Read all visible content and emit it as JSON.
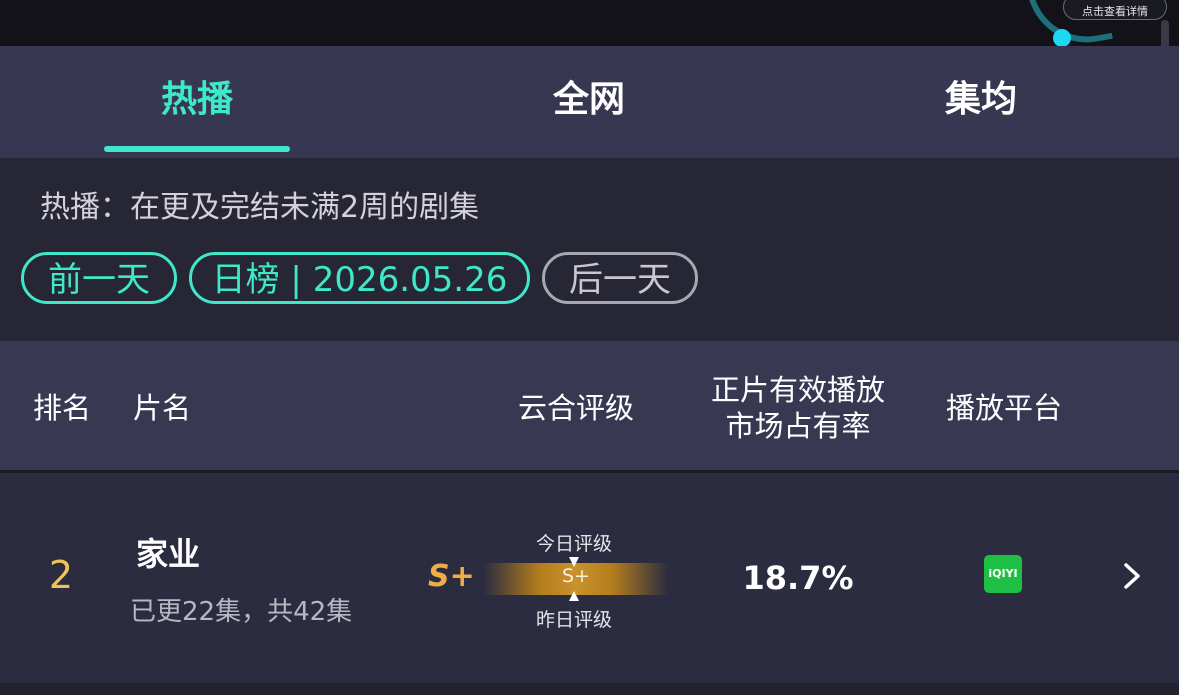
{
  "top_bar": {
    "detail_label": "点击查看详情",
    "accent_color": "#1ed7f0"
  },
  "tabs": [
    {
      "label": "热播",
      "active": true
    },
    {
      "label": "全网",
      "active": false
    },
    {
      "label": "集均",
      "active": false
    }
  ],
  "info": {
    "description": "热播：在更及完结未满2周的剧集",
    "prev_label": "前一天",
    "date_label": "日榜 | 2026.05.26",
    "next_label": "后一天"
  },
  "table": {
    "headers": {
      "rank": "排名",
      "title": "片名",
      "rating": "云合评级",
      "share_line1": "正片有效播放",
      "share_line2": "市场占有率",
      "platform": "播放平台"
    },
    "rows": [
      {
        "rank": "2",
        "title": "家业",
        "episodes": "已更22集，共42集",
        "grade": "S+",
        "today_label": "今日评级",
        "bar_grade": "S+",
        "yesterday_label": "昨日评级",
        "share": "18.7%",
        "platform_logo_text": "iQIYI",
        "platform_icon": "iqiyi-logo-icon"
      }
    ]
  },
  "colors": {
    "accent": "#3ee8c8",
    "rank": "#f2c25a",
    "grade": "#f0ad45",
    "platform": "#1fbf45"
  }
}
